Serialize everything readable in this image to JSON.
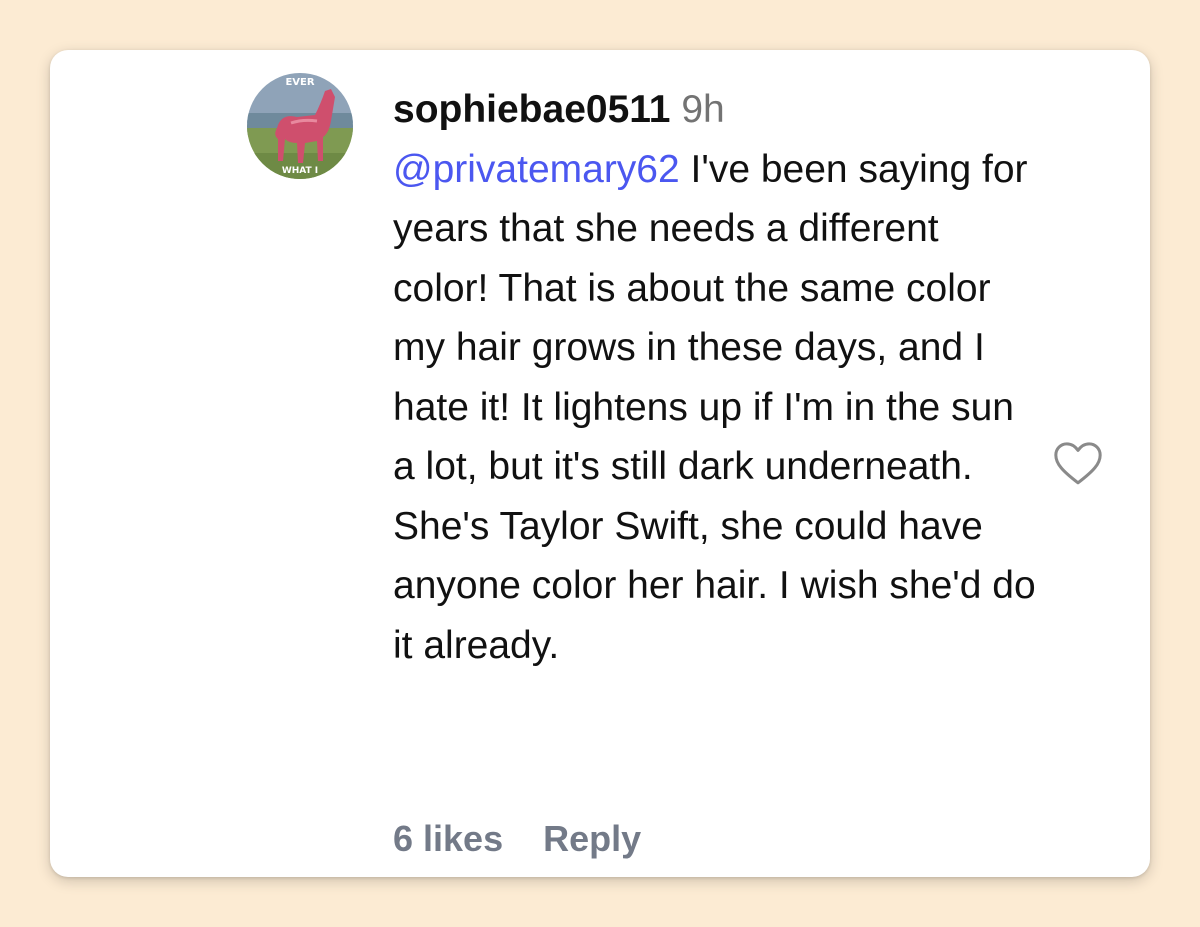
{
  "comment": {
    "username": "sophiebae0511",
    "time": "9h",
    "mention": "@privatemary62",
    "body": "I've been saying for years that she needs a different color! That is about the same color my hair grows in these days, and I hate it! It lightens up if I'm in the sun a lot, but it's still dark underneath. She's Taylor Swift, she could have anyone color her hair. I wish she'd do it already.",
    "likes": "6 likes",
    "reply_label": "Reply"
  },
  "avatar": {
    "top_text": "EVER",
    "bottom_text": "WHAT I"
  },
  "icons": {
    "like": "heart-icon"
  },
  "colors": {
    "background": "#fcebd3",
    "mention": "#4b57f0",
    "muted": "#737373",
    "footer": "#737a88"
  }
}
